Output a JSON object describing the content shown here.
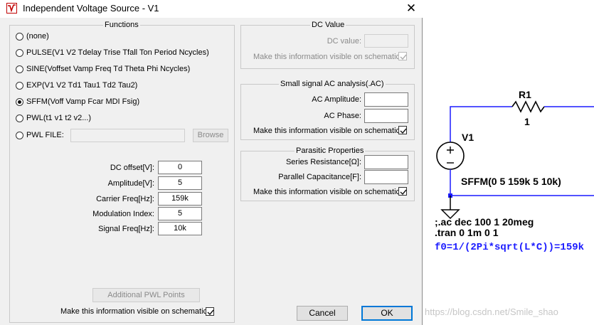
{
  "window": {
    "title": "Independent Voltage Source - V1",
    "close_glyph": "✕"
  },
  "functions": {
    "group_label": "Functions",
    "options": [
      {
        "label": "(none)",
        "checked": false
      },
      {
        "label": "PULSE(V1 V2 Tdelay Trise Tfall Ton Period Ncycles)",
        "checked": false
      },
      {
        "label": "SINE(Voffset Vamp Freq Td Theta Phi Ncycles)",
        "checked": false
      },
      {
        "label": "EXP(V1 V2 Td1 Tau1 Td2 Tau2)",
        "checked": false
      },
      {
        "label": "SFFM(Voff Vamp Fcar MDI Fsig)",
        "checked": true
      },
      {
        "label": "PWL(t1 v1 t2 v2...)",
        "checked": false
      },
      {
        "label": "PWL FILE:",
        "checked": false
      }
    ],
    "pwl_file_value": "",
    "browse_label": "Browse",
    "params": [
      {
        "label": "DC offset[V]:",
        "value": "0"
      },
      {
        "label": "Amplitude[V]:",
        "value": "5"
      },
      {
        "label": "Carrier Freq[Hz]:",
        "value": "159k"
      },
      {
        "label": "Modulation Index:",
        "value": "5"
      },
      {
        "label": "Signal Freq[Hz]:",
        "value": "10k"
      }
    ],
    "additional_pwl_label": "Additional PWL Points",
    "visible_label": "Make this information visible on schematic:",
    "visible_checked": true
  },
  "dc_value": {
    "group_label": "DC Value",
    "dc_label": "DC value:",
    "dc_value": "",
    "visible_label": "Make this information visible on schematic:",
    "visible_checked": true
  },
  "ac": {
    "group_label": "Small signal AC analysis(.AC)",
    "amplitude_label": "AC Amplitude:",
    "amplitude_value": "",
    "phase_label": "AC Phase:",
    "phase_value": "",
    "visible_label": "Make this information visible on schematic:",
    "visible_checked": true
  },
  "parasitic": {
    "group_label": "Parasitic Properties",
    "series_label": "Series Resistance[Ω]:",
    "series_value": "",
    "parallel_label": "Parallel Capacitance[F]:",
    "parallel_value": "",
    "visible_label": "Make this information visible on schematic:",
    "visible_checked": true
  },
  "buttons": {
    "cancel": "Cancel",
    "ok": "OK"
  },
  "schematic": {
    "resistor_name": "R1",
    "resistor_value": "1",
    "source_name": "V1",
    "source_value": "SFFM(0 5 159k 5 10k)",
    "directive_ac": ";.ac dec 100 1 20meg",
    "directive_tran": ".tran 0 1m 0 1",
    "comment": "f0=1/(2Pi*sqrt(L*C))=159k"
  },
  "watermark": "https://blog.csdn.net/Smile_shao",
  "colors": {
    "dialog_bg": "#f0f0f0",
    "ok_border": "#0078d7",
    "comment_blue": "#1a1aff"
  }
}
